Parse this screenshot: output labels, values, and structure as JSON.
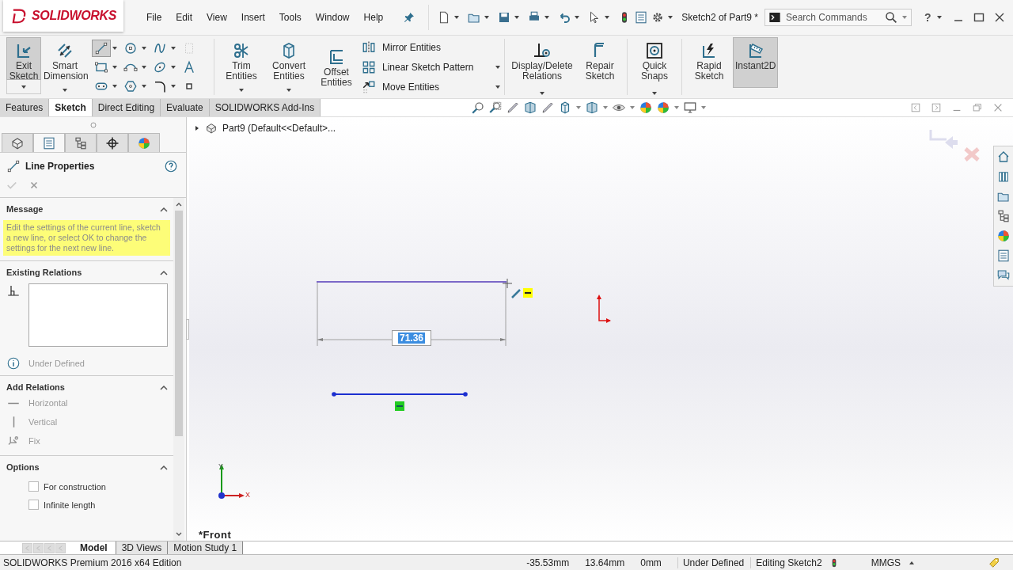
{
  "app": {
    "logo": "SOLIDWORKS"
  },
  "menu": [
    "File",
    "Edit",
    "View",
    "Insert",
    "Tools",
    "Window",
    "Help"
  ],
  "document_title": "Sketch2 of Part9 *",
  "search": {
    "placeholder": "Search Commands"
  },
  "help": "?",
  "ribbon": {
    "exit_sketch": {
      "label": "Exit Sketch",
      "selected": true
    },
    "smart_dimension": {
      "label": "Smart Dimension"
    },
    "sketch_tools": [
      {
        "kind": "line",
        "selected": true
      },
      {
        "kind": "circle",
        "selected": false
      },
      {
        "kind": "spline",
        "selected": false
      },
      {
        "kind": "plane",
        "selected": false
      },
      {
        "kind": "rectangle",
        "selected": false
      },
      {
        "kind": "arc",
        "selected": false
      },
      {
        "kind": "ellipse",
        "selected": false
      },
      {
        "kind": "text",
        "selected": false
      },
      {
        "kind": "slot",
        "selected": false
      },
      {
        "kind": "polygon",
        "selected": false
      },
      {
        "kind": "fillet",
        "selected": false
      },
      {
        "kind": "point",
        "selected": false
      }
    ],
    "modify_tools": [
      {
        "label": "Trim Entities"
      },
      {
        "label": "Convert Entities"
      },
      {
        "label": "Offset Entities"
      }
    ],
    "pattern_tools": [
      {
        "label": "Mirror Entities"
      },
      {
        "label": "Linear Sketch Pattern"
      },
      {
        "label": "Move Entities"
      }
    ],
    "relation_tools": [
      {
        "label": "Display/Delete Relations",
        "selected": false
      },
      {
        "label": "Repair Sketch",
        "selected": false
      },
      {
        "label": "Quick Snaps",
        "selected": false
      },
      {
        "label": "Rapid Sketch",
        "selected": false
      },
      {
        "label": "Instant2D",
        "selected": true
      }
    ]
  },
  "tabs": [
    {
      "label": "Features",
      "selected": false
    },
    {
      "label": "Sketch",
      "selected": true
    },
    {
      "label": "Direct Editing",
      "selected": false
    },
    {
      "label": "Evaluate",
      "selected": false
    },
    {
      "label": "SOLIDWORKS Add-Ins",
      "selected": false
    }
  ],
  "panel_tabs": [
    {
      "selected": false
    },
    {
      "selected": true
    },
    {
      "selected": false
    },
    {
      "selected": false
    },
    {
      "selected": false
    }
  ],
  "property_manager": {
    "title": "Line Properties",
    "message": {
      "heading": "Message",
      "text": "Edit the settings of the current line, sketch a new line, or select OK to change the settings for the next new line."
    },
    "existing_relations": {
      "heading": "Existing Relations",
      "status": "Under Defined"
    },
    "add_relations": {
      "heading": "Add Relations",
      "items": [
        {
          "label": "Horizontal",
          "kind": "horizontal",
          "disabled": true
        },
        {
          "label": "Vertical",
          "kind": "vertical",
          "disabled": true
        },
        {
          "label": "Fix",
          "kind": "fix",
          "disabled": true
        }
      ]
    },
    "options": {
      "heading": "Options",
      "items": [
        {
          "label": "For construction",
          "checked": false
        },
        {
          "label": "Infinite length",
          "checked": false
        }
      ]
    }
  },
  "canvas": {
    "tree_root": "Part9  (Default<<Default>...",
    "dimension": "71.36",
    "view": "*Front",
    "triad": {
      "y": "Y",
      "x": "X"
    }
  },
  "bottom_tabs": [
    {
      "label": "Model",
      "selected": true
    },
    {
      "label": "3D Views",
      "selected": false
    },
    {
      "label": "Motion Study 1",
      "selected": false
    }
  ],
  "status_bar": {
    "edition": "SOLIDWORKS Premium 2016 x64 Edition",
    "x": "-35.53mm",
    "y": "13.64mm",
    "z": "0mm",
    "state": "Under Defined",
    "editing": "Editing Sketch2",
    "units": "MMGS"
  }
}
